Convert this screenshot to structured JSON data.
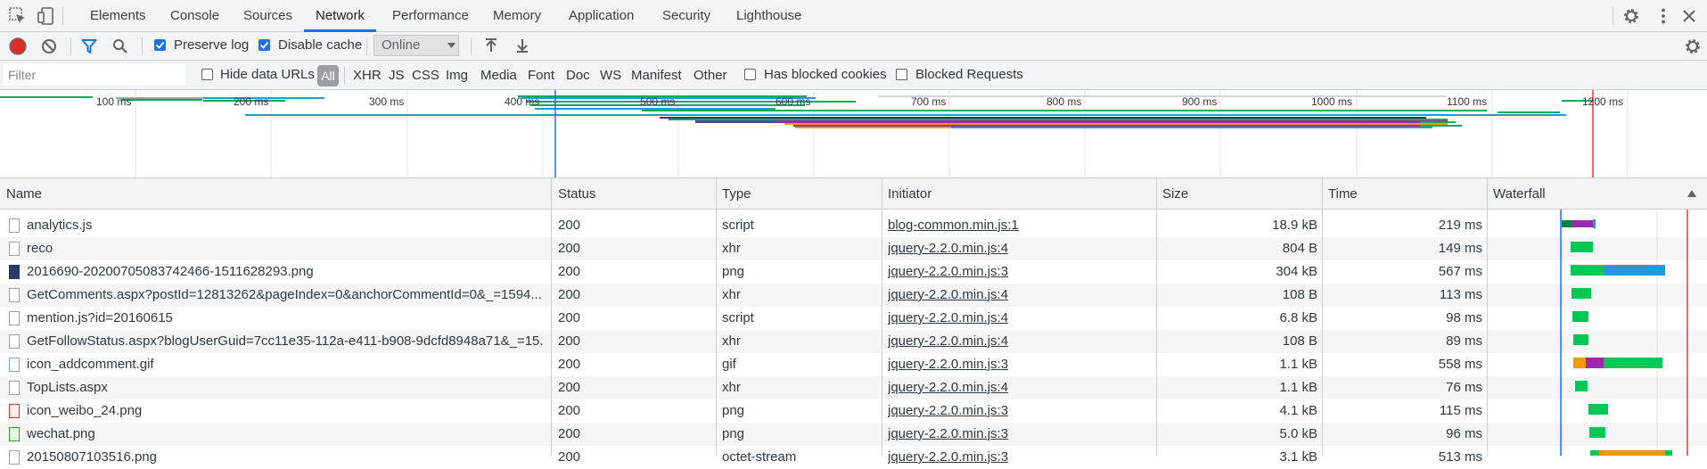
{
  "tabs": [
    "Elements",
    "Console",
    "Sources",
    "Network",
    "Performance",
    "Memory",
    "Application",
    "Security",
    "Lighthouse"
  ],
  "toolbar": {
    "preserve_log": "Preserve log",
    "disable_cache": "Disable cache",
    "throttle": "Online"
  },
  "filterbar": {
    "placeholder": "Filter",
    "hide_data_urls": "Hide data URLs",
    "all": "All",
    "types": [
      "XHR",
      "JS",
      "CSS",
      "Img",
      "Media",
      "Font",
      "Doc",
      "WS",
      "Manifest",
      "Other"
    ],
    "has_blocked_cookies": "Has blocked cookies",
    "blocked_requests": "Blocked Requests"
  },
  "overview": {
    "ticks": [
      "100 ms",
      "200 ms",
      "300 ms",
      "400 ms",
      "500 ms",
      "600 ms",
      "700 ms",
      "800 ms",
      "900 ms",
      "1000 ms",
      "1100 ms",
      "1200 ms"
    ]
  },
  "table": {
    "columns": {
      "name": "Name",
      "status": "Status",
      "type": "Type",
      "initiator": "Initiator",
      "size": "Size",
      "time": "Time",
      "waterfall": "Waterfall"
    },
    "rows": [
      {
        "name": "analytics.js",
        "status": "200",
        "type": "script",
        "initiator": "blog-common.min.js:1",
        "size": "18.9 kB",
        "time": "219 ms"
      },
      {
        "name": "reco",
        "status": "200",
        "type": "xhr",
        "initiator": "jquery-2.2.0.min.js:4",
        "size": "804 B",
        "time": "149 ms"
      },
      {
        "name": "2016690-20200705083742466-1511628293.png",
        "status": "200",
        "type": "png",
        "initiator": "jquery-2.2.0.min.js:3",
        "size": "304 kB",
        "time": "567 ms"
      },
      {
        "name": "GetComments.aspx?postId=12813262&pageIndex=0&anchorCommentId=0&_=1594...",
        "status": "200",
        "type": "xhr",
        "initiator": "jquery-2.2.0.min.js:4",
        "size": "108 B",
        "time": "113 ms"
      },
      {
        "name": "mention.js?id=20160615",
        "status": "200",
        "type": "script",
        "initiator": "jquery-2.2.0.min.js:4",
        "size": "6.8 kB",
        "time": "98 ms"
      },
      {
        "name": "GetFollowStatus.aspx?blogUserGuid=7cc11e35-112a-e411-b908-9dcfd8948a71&_=15...",
        "status": "200",
        "type": "xhr",
        "initiator": "jquery-2.2.0.min.js:4",
        "size": "108 B",
        "time": "89 ms"
      },
      {
        "name": "icon_addcomment.gif",
        "status": "200",
        "type": "gif",
        "initiator": "jquery-2.2.0.min.js:3",
        "size": "1.1 kB",
        "time": "558 ms"
      },
      {
        "name": "TopLists.aspx",
        "status": "200",
        "type": "xhr",
        "initiator": "jquery-2.2.0.min.js:4",
        "size": "1.1 kB",
        "time": "76 ms"
      },
      {
        "name": "icon_weibo_24.png",
        "status": "200",
        "type": "png",
        "initiator": "jquery-2.2.0.min.js:3",
        "size": "4.1 kB",
        "time": "115 ms"
      },
      {
        "name": "wechat.png",
        "status": "200",
        "type": "png",
        "initiator": "jquery-2.2.0.min.js:3",
        "size": "5.0 kB",
        "time": "96 ms"
      },
      {
        "name": "20150807103516.png",
        "status": "200",
        "type": "octet-stream",
        "initiator": "jquery-2.2.0.min.js:3",
        "size": "3.1 kB",
        "time": "513 ms"
      }
    ]
  },
  "colors": {
    "accent": "#1a73e8",
    "record": "#d93025",
    "waiting": "#00c853",
    "download": "#1e9ae0",
    "queue": "#f29900",
    "ssl": "#9c27b0",
    "connect": "#ff8c00"
  }
}
